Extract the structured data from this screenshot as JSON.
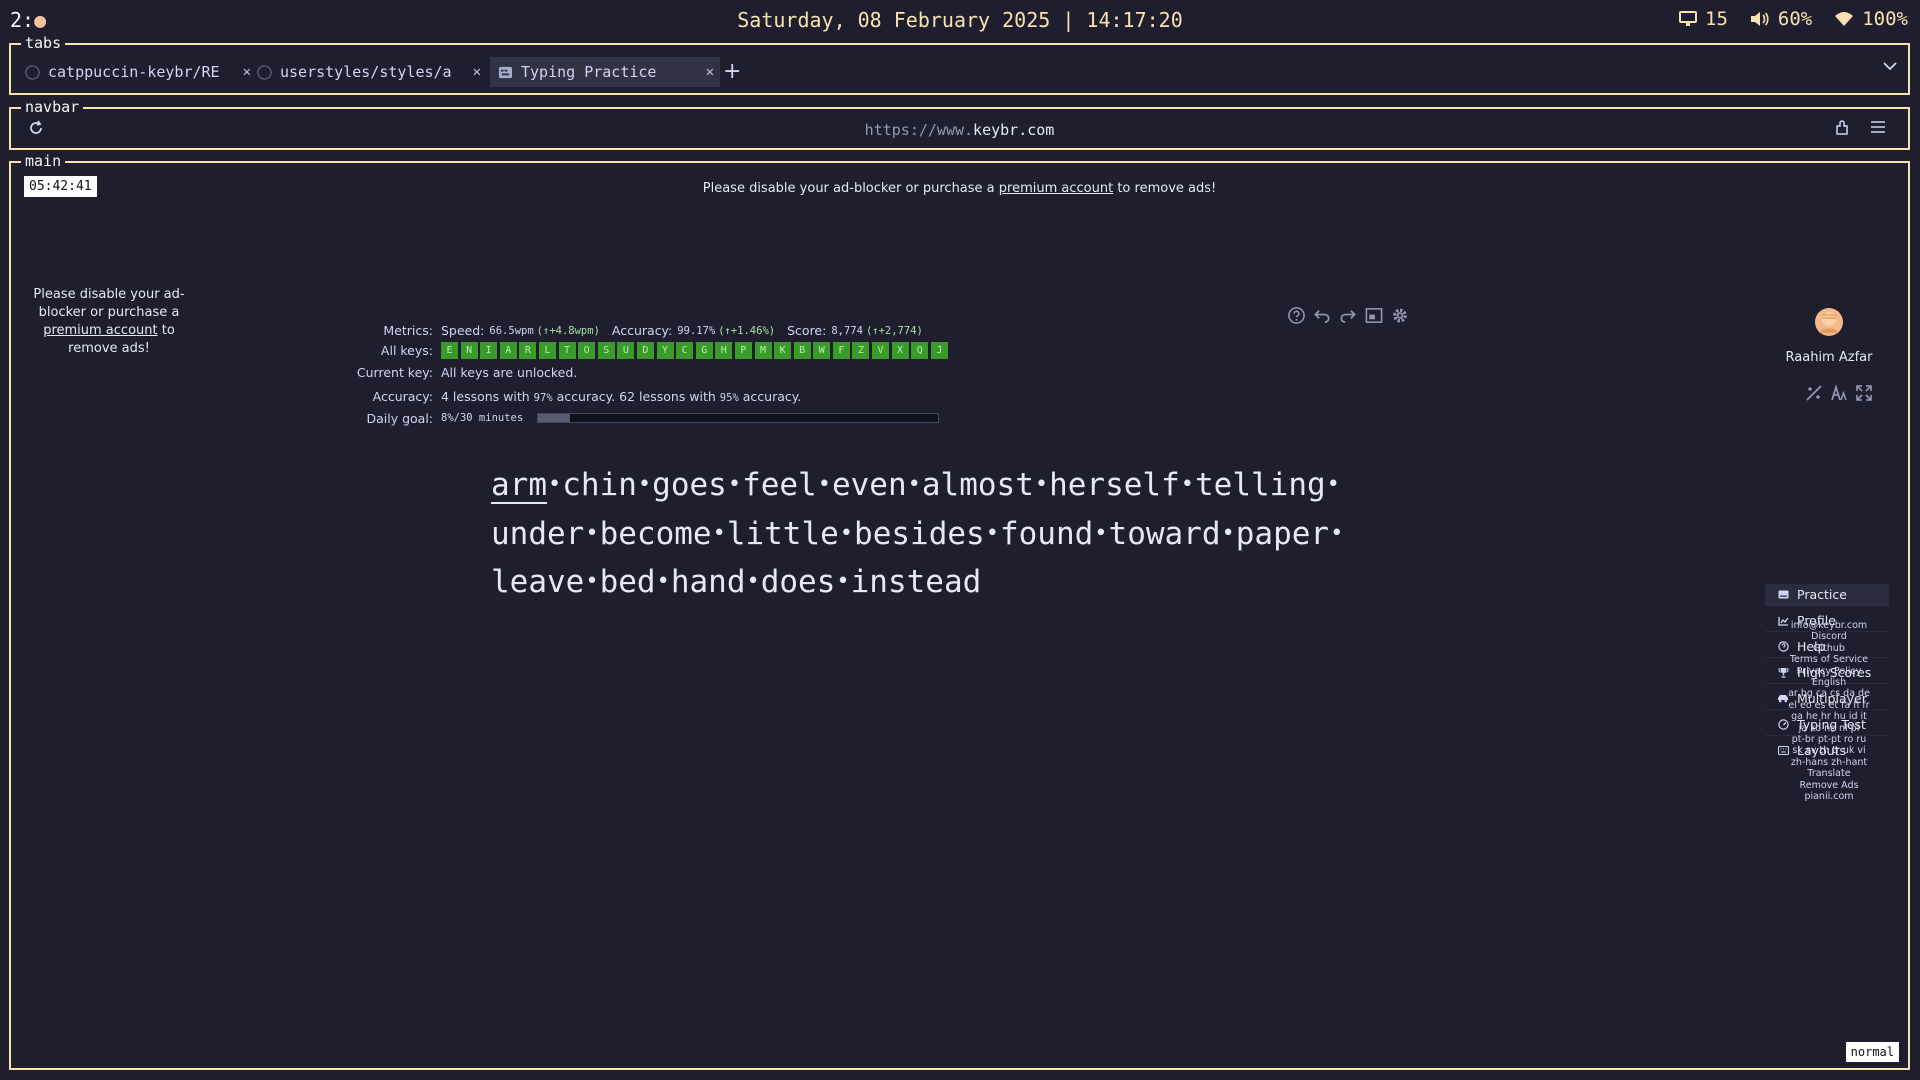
{
  "statusbar": {
    "workspace": "2:",
    "datetime": "Saturday, 08 February 2025 | 14:17:20",
    "updates": "15",
    "volume": "60%",
    "wifi": "100%"
  },
  "tabs_section": {
    "label": "tabs",
    "tabs": [
      {
        "title": "catppuccin-keybr/README",
        "icon": "github-icon",
        "active": false
      },
      {
        "title": "userstyles/styles/arch",
        "icon": "github-icon",
        "active": false
      },
      {
        "title": "Typing Practice",
        "icon": "keybr-icon",
        "active": true
      }
    ],
    "add": "+"
  },
  "navbar": {
    "label": "navbar",
    "url_scheme": "https://www.",
    "url_host": "keybr.com"
  },
  "main": {
    "label": "main",
    "timer": "05:42:41",
    "ad_top": {
      "pre": "Please disable your ad-blocker or purchase a ",
      "link": "premium account",
      "post": " to remove ads!"
    },
    "ad_side": {
      "pre": "Please disable your ad-blocker or purchase a ",
      "link": "premium account",
      "post": " to remove ads!"
    },
    "metrics": {
      "labels": {
        "metrics": "Metrics:",
        "all_keys": "All keys:",
        "current_key": "Current key:",
        "accuracy": "Accuracy:",
        "daily_goal": "Daily goal:"
      },
      "speed_label": "Speed:",
      "speed_value": "66.5wpm",
      "speed_delta": "(↑+4.8wpm)",
      "accuracy_label": "Accuracy:",
      "accuracy_value": "99.17%",
      "accuracy_delta": "(↑+1.46%)",
      "score_label": "Score:",
      "score_value": "8,774",
      "score_delta": "(↑+2,774)",
      "keys": [
        "E",
        "N",
        "I",
        "A",
        "R",
        "L",
        "T",
        "O",
        "S",
        "U",
        "D",
        "Y",
        "C",
        "G",
        "H",
        "P",
        "M",
        "K",
        "B",
        "W",
        "F",
        "Z",
        "V",
        "X",
        "Q",
        "J"
      ],
      "current_key": "All keys are unlocked.",
      "accuracy_text": {
        "a": "4 lessons with ",
        "b": "97%",
        "c": " accuracy. 62 lessons with ",
        "d": "95%",
        "e": " accuracy."
      },
      "daily_goal_text": "8%/30 minutes",
      "daily_goal_progress": 0.08
    },
    "typing_lines": [
      [
        "arm",
        "chin",
        "goes",
        "feel",
        "even",
        "almost",
        "herself",
        "telling"
      ],
      [
        "under",
        "become",
        "little",
        "besides",
        "found",
        "toward",
        "paper"
      ],
      [
        "leave",
        "bed",
        "hand",
        "does",
        "instead"
      ]
    ]
  },
  "sidebar": {
    "username": "Raahim Azfar",
    "nav": [
      {
        "label": "Practice",
        "icon": "keyboard-icon",
        "active": true
      },
      {
        "label": "Profile",
        "icon": "chart-icon",
        "active": false
      },
      {
        "label": "Help",
        "icon": "help-icon",
        "active": false
      },
      {
        "label": "High Scores",
        "icon": "trophy-icon",
        "active": false
      },
      {
        "label": "Multiplayer",
        "icon": "car-icon",
        "active": false
      },
      {
        "label": "Typing Test",
        "icon": "gauge-icon",
        "active": false
      },
      {
        "label": "Layouts",
        "icon": "keyboard-layout-icon",
        "active": false
      }
    ],
    "footer": [
      "info@keybr.com",
      "Discord",
      "Github",
      "Terms of Service",
      "Privacy Policy",
      "English",
      "ar bg ca cs da de",
      "el eo es et fa fi fr",
      "ga he hr hu id it",
      "ja ko ne nl pl",
      "pt-br pt-pt ro ru",
      "sk sv th tr uk vi",
      "zh-hans zh-hant",
      "Translate",
      "Remove Ads",
      "pianii.com"
    ]
  },
  "mode": "normal",
  "colors": {
    "accent": "#f9e2af",
    "background": "#1e1e2e",
    "key_unlocked": "#3a9a2a",
    "delta": "#a6e3a1"
  }
}
